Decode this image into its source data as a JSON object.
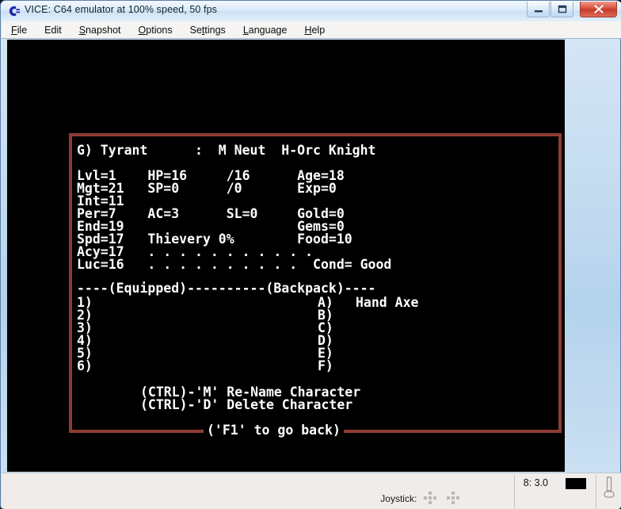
{
  "window": {
    "title": "VICE: C64 emulator at 100% speed, 50 fps",
    "app_icon": "commodore-logo-icon",
    "controls": {
      "minimize": "minimize-icon",
      "maximize": "maximize-icon",
      "close": "close-icon"
    }
  },
  "menubar": {
    "items": [
      {
        "label": "File",
        "accesskey": "F"
      },
      {
        "label": "Edit",
        "accesskey": ""
      },
      {
        "label": "Snapshot",
        "accesskey": "S"
      },
      {
        "label": "Options",
        "accesskey": "O"
      },
      {
        "label": "Settings",
        "accesskey": "t"
      },
      {
        "label": "Language",
        "accesskey": "L"
      },
      {
        "label": "Help",
        "accesskey": "H"
      }
    ]
  },
  "screen": {
    "border_color": "#8f3c32",
    "background_color": "#000000",
    "text_color": "#ffffff",
    "header": "G) Tyrant      :  M Neut  H-Orc Knight",
    "character": {
      "slot": "G)",
      "name": "Tyrant",
      "sex": "M",
      "alignment": "Neut",
      "race": "H-Orc",
      "class": "Knight"
    },
    "stats_lines": [
      "Lvl=1    HP=16     /16      Age=18",
      "Mgt=21   SP=0      /0       Exp=0",
      "Int=11",
      "Per=7    AC=3      SL=0     Gold=0",
      "End=19                      Gems=0",
      "Spd=17   Thievery 0%        Food=10",
      "Acy=17   . . . . . . . . . . .",
      "Luc=16   . . . . . . . . . .  Cond= Good"
    ],
    "stats": {
      "Lvl": "1",
      "Mgt": "21",
      "Int": "11",
      "Per": "7",
      "End": "19",
      "Spd": "17",
      "Acy": "17",
      "Luc": "16",
      "HP": "16",
      "HP_max": "/16",
      "SP": "0",
      "SP_max": "/0",
      "AC": "3",
      "SL": "0",
      "Thievery": "0%",
      "Age": "18",
      "Exp": "0",
      "Gold": "0",
      "Gems": "0",
      "Food": "10",
      "Cond": "Good"
    },
    "section_rule": "----(Equipped)----------(Backpack)----",
    "equipped_header": "(Equipped)",
    "backpack_header": "(Backpack)",
    "equipped_slots": [
      "1)",
      "2)",
      "3)",
      "4)",
      "5)",
      "6)"
    ],
    "backpack_slots": [
      "A)",
      "B)",
      "C)",
      "D)",
      "E)",
      "F)"
    ],
    "backpack_items": [
      "Hand Axe",
      "",
      "",
      "",
      "",
      ""
    ],
    "commands": [
      "(CTRL)-'M' Re-Name Character",
      "(CTRL)-'D' Delete Character"
    ],
    "footer": "('F1' to go back)"
  },
  "statusbar": {
    "joystick_label": "Joystick:",
    "joystick_icon_1": "dpad-icon",
    "joystick_icon_2": "dpad-icon",
    "drive_status": "8: 3.0",
    "drive_led": "drive-led-indicator",
    "tape_icon": "tape-drive-icon"
  }
}
